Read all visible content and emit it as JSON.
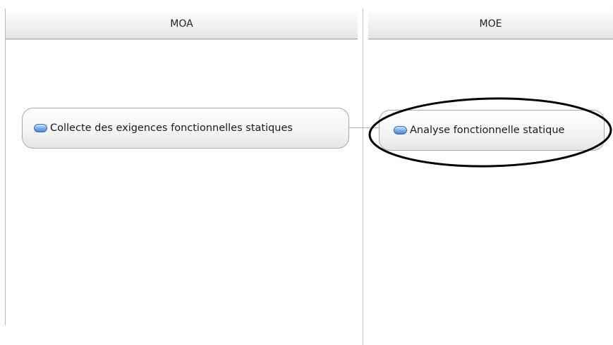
{
  "lanes": [
    {
      "title": "MOA"
    },
    {
      "title": "MOE"
    }
  ],
  "activities": [
    {
      "label": "Collecte des exigences fonctionnelles statiques",
      "icon": "activity-pill-icon"
    },
    {
      "label": "Analyse fonctionnelle statique",
      "icon": "activity-pill-icon",
      "highlighted": true
    }
  ],
  "colors": {
    "highlight_ellipse": "#000000",
    "icon_blue": "#4a86cf"
  }
}
